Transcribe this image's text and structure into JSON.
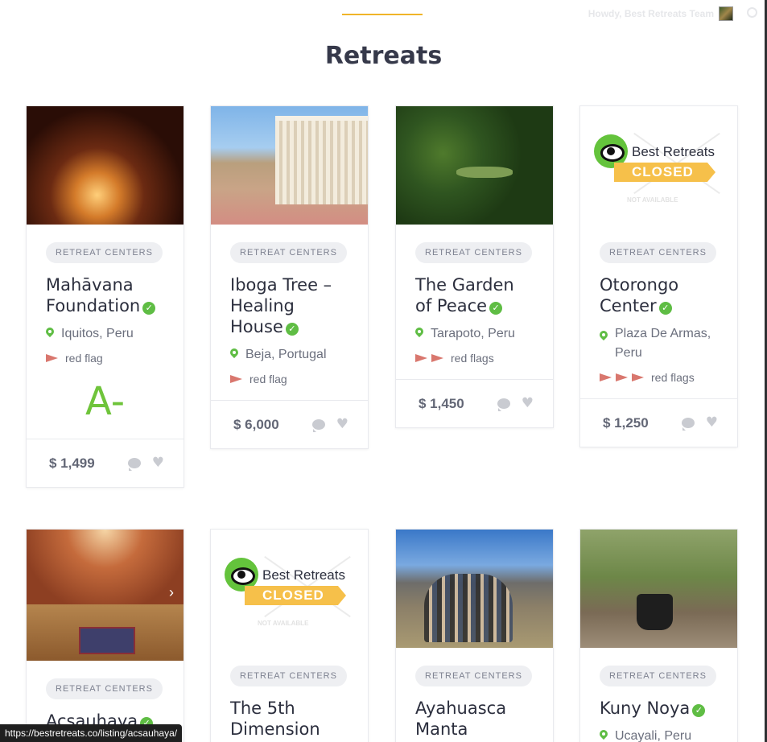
{
  "header": {
    "howdy": "Howdy, Best Retreats Team"
  },
  "page": {
    "title": "Retreats"
  },
  "closed_logo": {
    "brand": "Best Retreats",
    "closed": "CLOSED",
    "not_available": "NOT AVAILABLE"
  },
  "cards": [
    {
      "category": "RETREAT CENTERS",
      "name": "Mahāvana Foundation",
      "location": "Iquitos, Peru",
      "flags_label": "red flag",
      "grade": "A-",
      "price": "$ 1,499"
    },
    {
      "category": "RETREAT CENTERS",
      "name": "Iboga Tree – Healing House",
      "location": "Beja, Portugal",
      "flags_label": "red flag",
      "price": "$ 6,000"
    },
    {
      "category": "RETREAT CENTERS",
      "name": "The Garden of Peace",
      "location": "Tarapoto, Peru",
      "flags_label": "red flags",
      "price": "$ 1,450"
    },
    {
      "category": "RETREAT CENTERS",
      "name": "Otorongo Center",
      "location": "Plaza De Armas, Peru",
      "flags_label": "red flags",
      "price": "$ 1,250"
    },
    {
      "category": "RETREAT CENTERS",
      "name": "Acsauhaya"
    },
    {
      "category": "RETREAT CENTERS",
      "name": "The 5th Dimension"
    },
    {
      "category": "RETREAT CENTERS",
      "name": "Ayahuasca Manta"
    },
    {
      "category": "RETREAT CENTERS",
      "name": "Kuny Noya",
      "location": "Ucayali, Peru"
    }
  ],
  "status_bar": {
    "url": "https://bestretreats.co/listing/acsauhaya/"
  }
}
